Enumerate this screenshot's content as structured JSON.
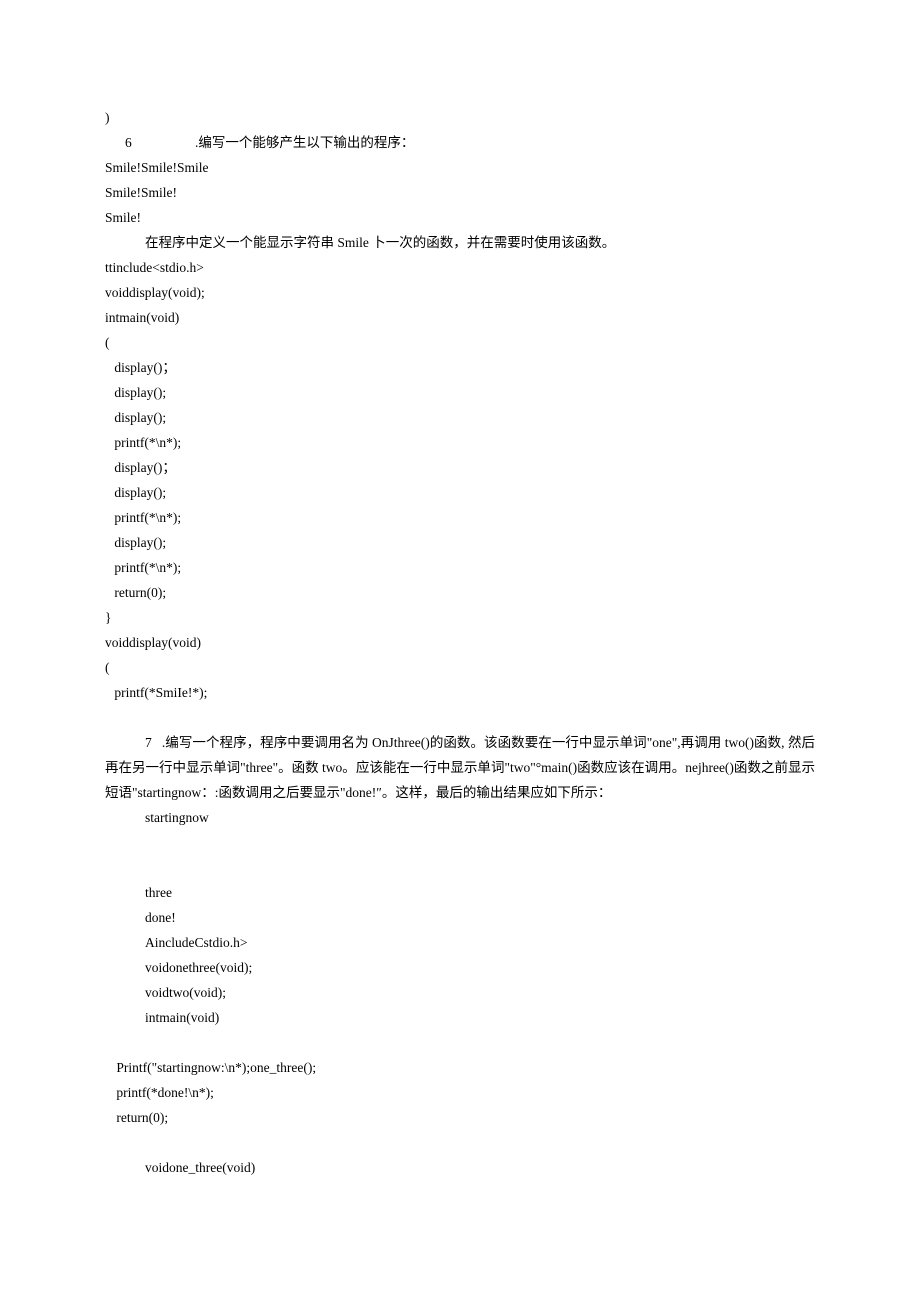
{
  "q6": {
    "close_paren": ")",
    "num": "6",
    "num_after": ".编写一个能够产生以下输出的程序：",
    "out1": "Smile!Smile!Smile",
    "out2": "Smile!Smile!",
    "out3": "Smile!",
    "desc": "在程序中定义一个能显示字符串 Smile 卜一次的函数，并在需要时使用该函数。",
    "code": [
      "ttinclude<stdio.h>",
      "voiddisplay(void);",
      "intmain(void)",
      "(",
      " display()；",
      " display();",
      " display();",
      " printf(*\\n*);",
      " display()；",
      " display();",
      " printf(*\\n*);",
      " display();",
      " printf(*\\n*);",
      " return(0);",
      "}",
      "voiddisplay(void)",
      "(",
      " printf(*SmiIe!*);"
    ]
  },
  "q7": {
    "num_prefix": "7   .",
    "para": "编写一个程序，程序中要调用名为 OnJthree()的函数。该函数要在一行中显示单词\"one\",再调用 two()函数, 然后再在另一行中显示单词\"three\"。函数 two。应该能在一行中显示单词\"two\"°main()函数应该在调用。nejhree()函数之前显示短语\"startingnow：:函数调用之后要显示\"done!″。这样，最后的输出结果应如下所示：",
    "out1": "startingnow",
    "out2": "three",
    "out3": "done!",
    "code": [
      "AincludeCstdio.h>",
      "voidonethree(void);",
      "voidtwo(void);",
      "intmain(void)",
      "",
      " Printf(\"startingnow:\\n*);one_three();",
      " printf(*done!\\n*);",
      " return(0);",
      "",
      "voidone_three(void)"
    ]
  }
}
